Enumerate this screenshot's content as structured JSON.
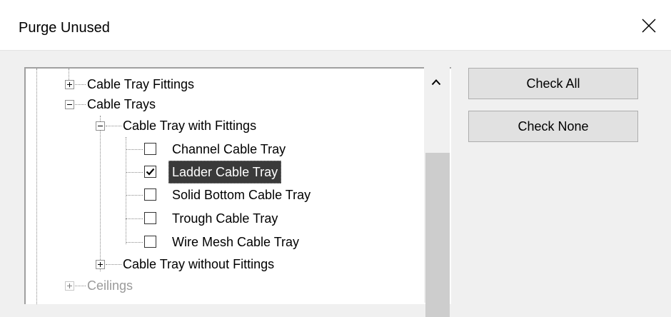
{
  "dialog": {
    "title": "Purge Unused"
  },
  "icons": {
    "close": "close-icon",
    "scroll_up": "chevron-up-icon"
  },
  "tree": {
    "items": [
      {
        "label": "Cable Tray Fittings",
        "expander": "plus"
      },
      {
        "label": "Cable Trays",
        "expander": "minus"
      },
      {
        "label": "Cable Tray with Fittings",
        "expander": "minus"
      },
      {
        "label": "Channel Cable Tray",
        "checked": false
      },
      {
        "label": "Ladder Cable Tray",
        "checked": true,
        "selected": true
      },
      {
        "label": "Solid Bottom Cable Tray",
        "checked": false
      },
      {
        "label": "Trough Cable Tray",
        "checked": false
      },
      {
        "label": "Wire Mesh Cable Tray",
        "checked": false
      },
      {
        "label": "Cable Tray without Fittings",
        "expander": "plus"
      },
      {
        "label": "Ceilings",
        "expander": "plus"
      }
    ]
  },
  "buttons": {
    "check_all": "Check All",
    "check_none": "Check None"
  }
}
